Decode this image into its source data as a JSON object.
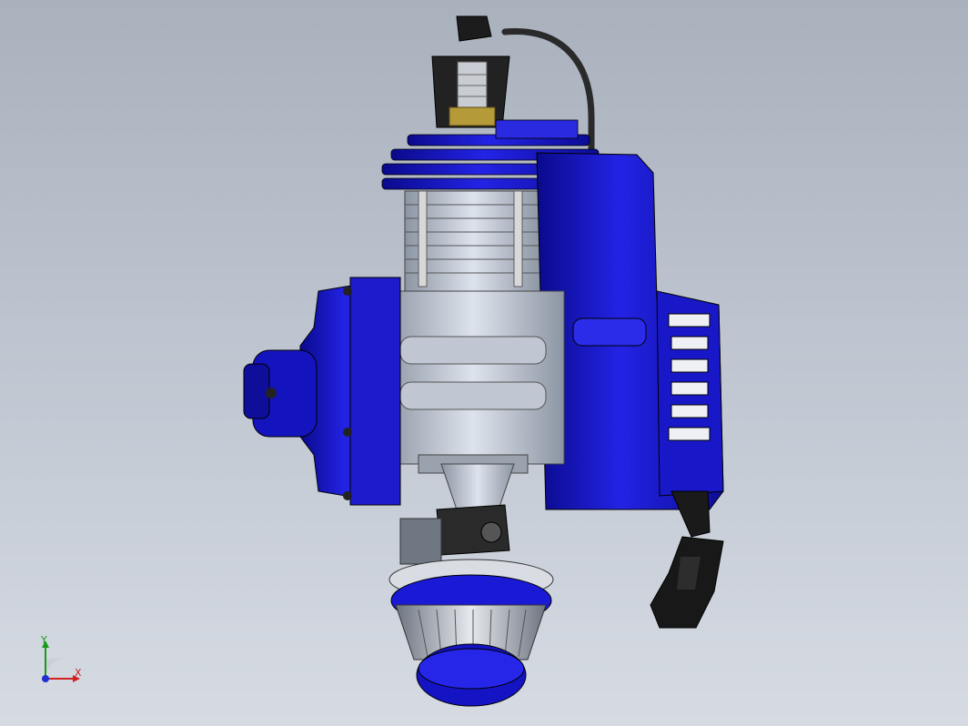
{
  "viewport": {
    "background_top": "#a9b1bd",
    "background_bottom": "#d6dbe3"
  },
  "model": {
    "description_icon": "engine-assembly",
    "colors": {
      "body_blue": "#1a1ad6",
      "dark_blue": "#0a0a8c",
      "highlight_blue": "#5a6cff",
      "metal": "#c4ccd8",
      "metal_dark": "#7e8796",
      "black": "#141414",
      "brass": "#b59a3a"
    }
  },
  "triad": {
    "x_label": "X",
    "y_label": "Y",
    "x_color": "#d22020",
    "y_color": "#1a9a1a",
    "z_color": "#2030d0"
  }
}
